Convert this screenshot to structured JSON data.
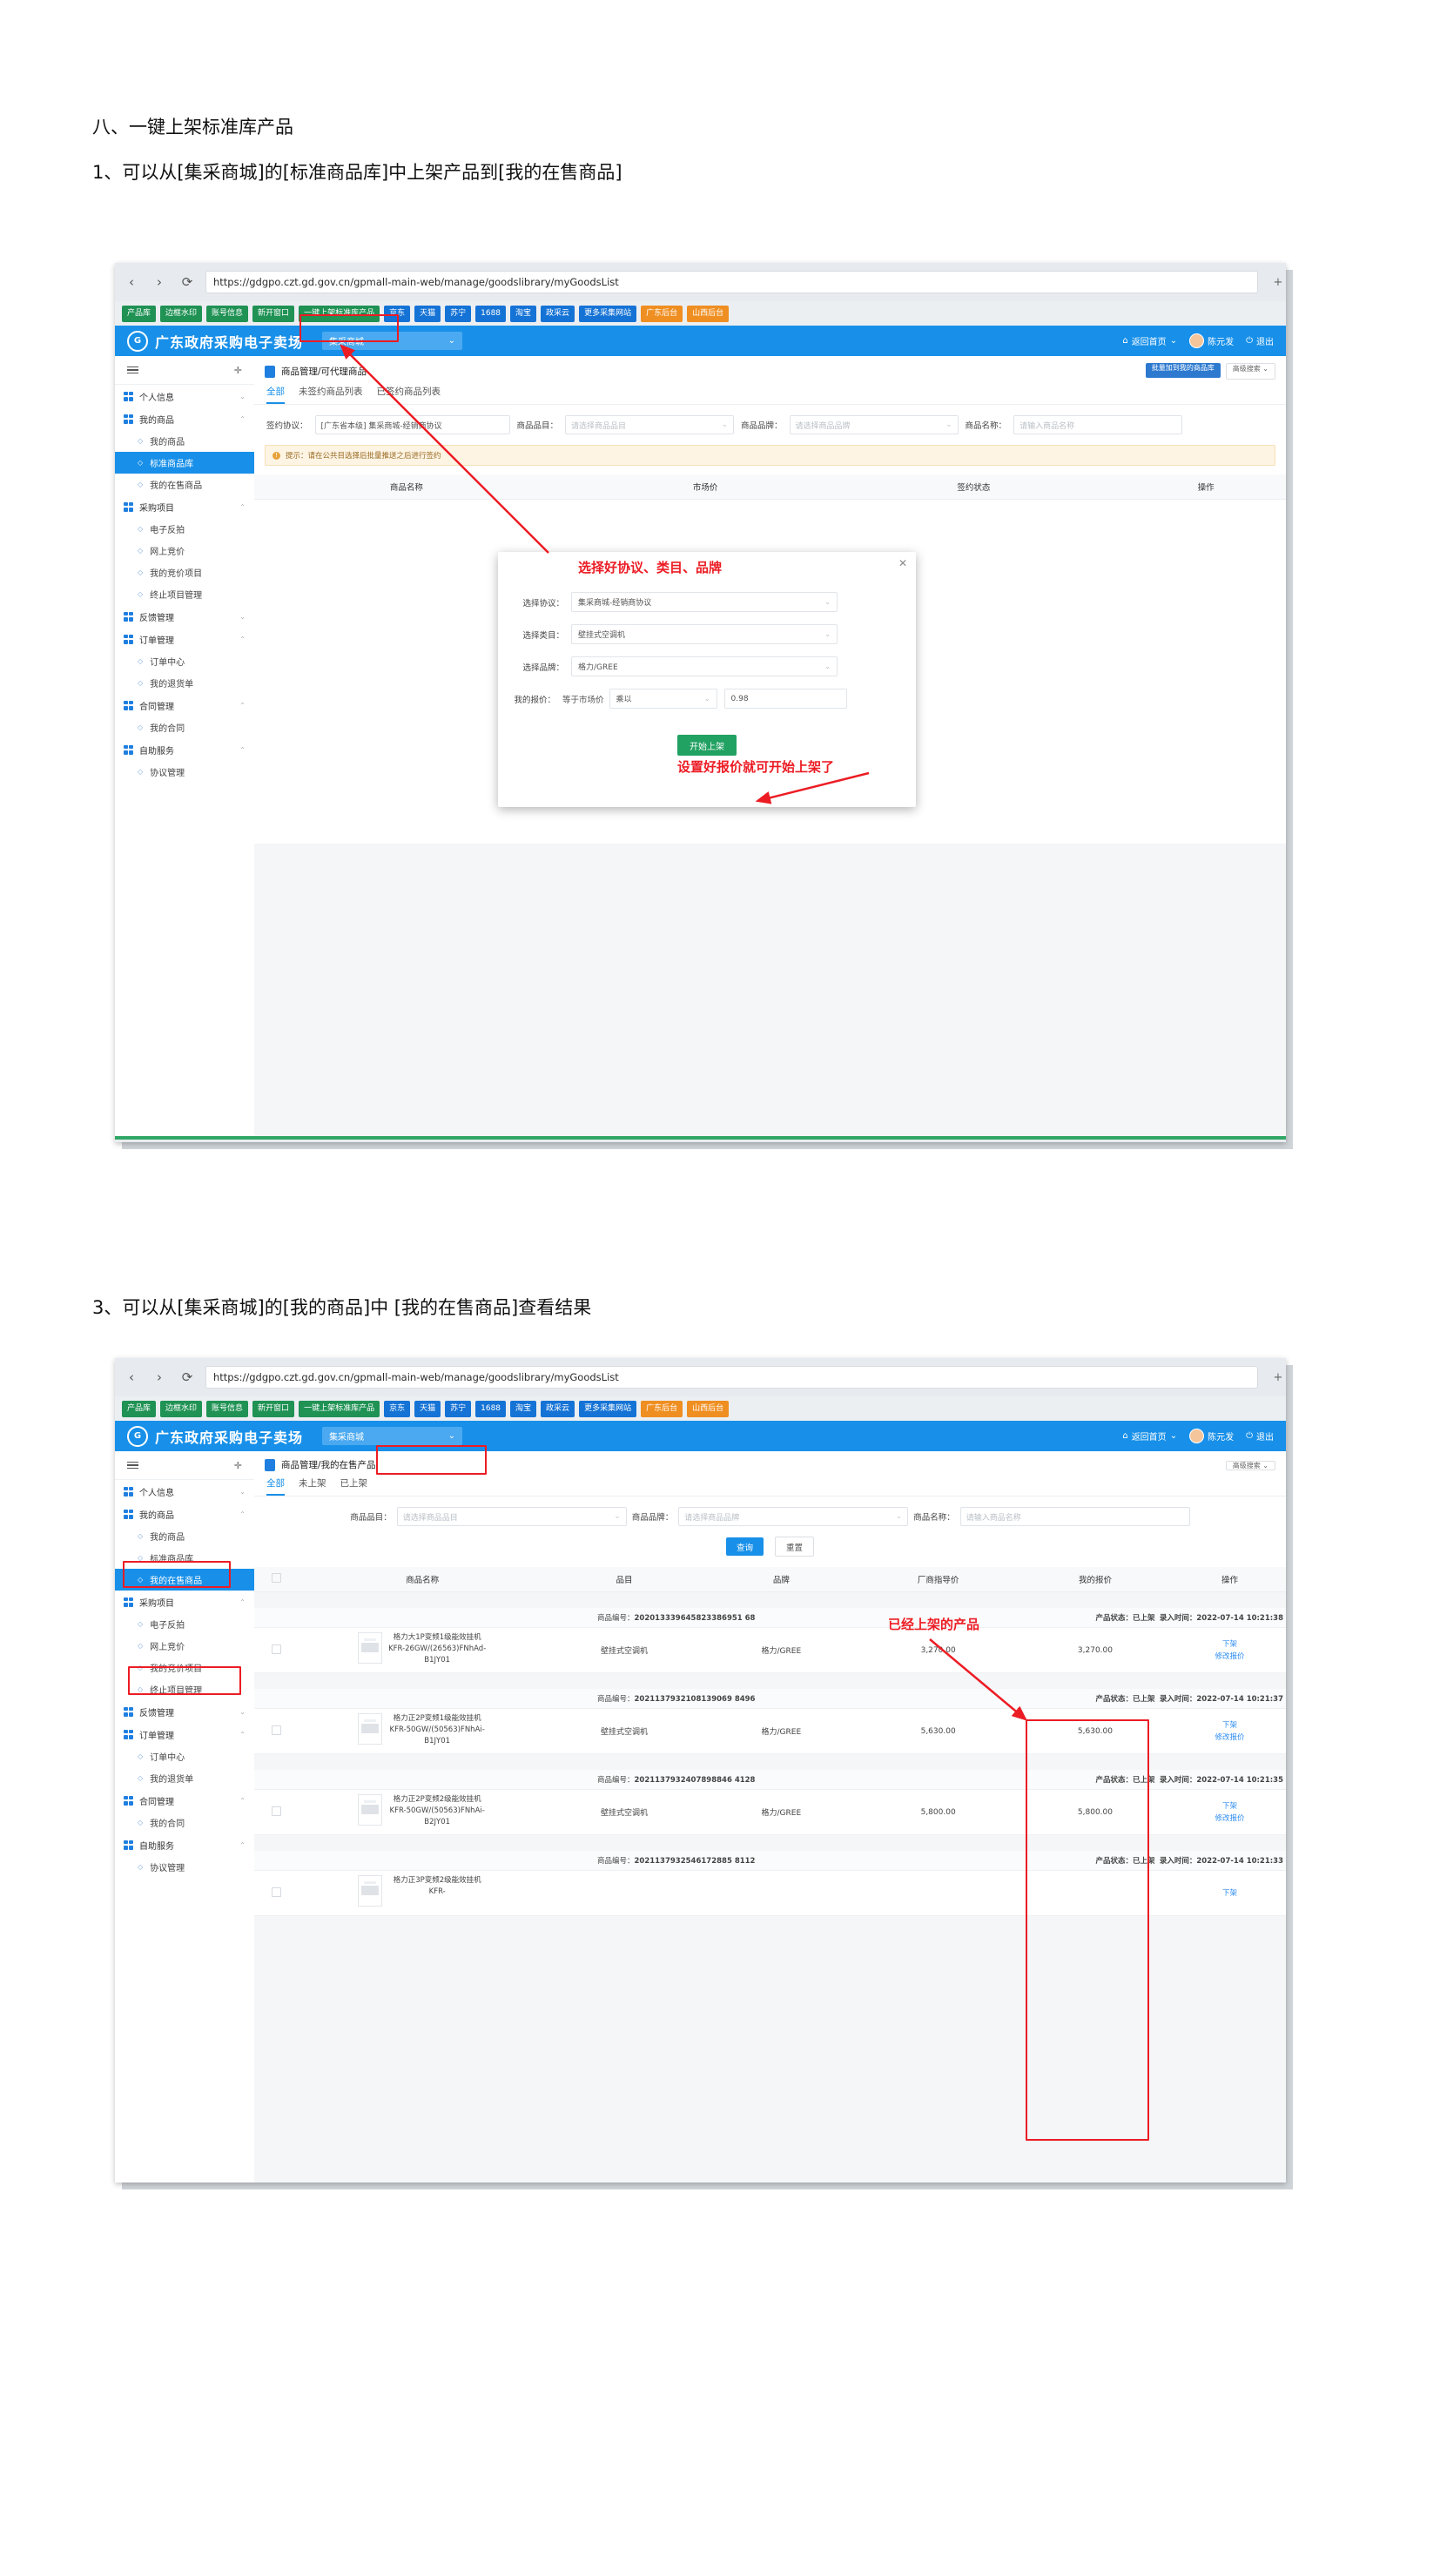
{
  "document": {
    "section_heading": "八、一键上架标准库产品",
    "line1": "1、可以从[集采商城]的[标准商品库]中上架产品到[我的在售商品]",
    "line3": "3、可以从[集采商城]的[我的商品]中 [我的在售商品]查看结果"
  },
  "browser": {
    "url": "https://gdgpo.czt.gd.gov.cn/gpmall-main-web/manage/goodslibrary/myGoodsList",
    "back_icon": "‹",
    "forward_icon": "›",
    "reload_icon": "⟳",
    "plus_icon": "+",
    "bookmarks": [
      {
        "label": "产品库",
        "color": "green"
      },
      {
        "label": "边框水印",
        "color": "green"
      },
      {
        "label": "账号信息",
        "color": "green"
      },
      {
        "label": "新开窗口",
        "color": "green"
      },
      {
        "label": "一键上架标准库产品",
        "color": "green"
      },
      {
        "label": "京东",
        "color": "blue"
      },
      {
        "label": "天猫",
        "color": "blue"
      },
      {
        "label": "苏宁",
        "color": "blue"
      },
      {
        "label": "1688",
        "color": "blue"
      },
      {
        "label": "淘宝",
        "color": "blue"
      },
      {
        "label": "政采云",
        "color": "blue"
      },
      {
        "label": "更多采集网站",
        "color": "blue"
      },
      {
        "label": "广东后台",
        "color": "orange"
      },
      {
        "label": "山西后台",
        "color": "orange"
      }
    ]
  },
  "appheader": {
    "logo_text": "G",
    "brand": "广东政府采购电子卖场",
    "mall_selector": "集采商城",
    "mall_caret": "⌄",
    "home_icon": "⌂",
    "home_label": "返回首页",
    "home_caret": "⌄",
    "user_name": "陈元发",
    "logout_icon": "⏻",
    "logout_label": "退出"
  },
  "sidebar": {
    "pin_icon": "📌",
    "groups": [
      {
        "label": "个人信息",
        "caret": "⌄",
        "children": []
      },
      {
        "label": "我的商品",
        "caret": "⌃",
        "children": [
          "我的商品",
          "标准商品库",
          "我的在售商品"
        ]
      },
      {
        "label": "采购项目",
        "caret": "⌃",
        "children": [
          "电子反拍",
          "网上竞价",
          "我的竞价项目",
          "终止项目管理"
        ]
      },
      {
        "label": "反馈管理",
        "caret": "⌄",
        "children": []
      },
      {
        "label": "订单管理",
        "caret": "⌃",
        "children": [
          "订单中心",
          "我的退货单"
        ]
      },
      {
        "label": "合同管理",
        "caret": "⌃",
        "children": [
          "我的合同"
        ]
      },
      {
        "label": "自助服务",
        "caret": "⌃",
        "children": [
          "协议管理"
        ]
      }
    ],
    "active_item_screen1": "标准商品库",
    "active_item_screen2": "我的在售商品"
  },
  "screen1": {
    "breadcrumb": "商品管理/可代理商品",
    "tabs": [
      {
        "label": "全部",
        "active": true
      },
      {
        "label": "未签约商品列表",
        "active": false
      },
      {
        "label": "已签约商品列表",
        "active": false
      }
    ],
    "top_buttons": [
      {
        "label": "批量加到我的商品库",
        "style": "primary"
      },
      {
        "label": "高级搜索 ⌄",
        "style": "default"
      }
    ],
    "filters": [
      {
        "label": "签约协议：",
        "value": "[广东省本级] 集采商城-经销商协议",
        "placeholder": "",
        "type": "text"
      },
      {
        "label": "商品品目：",
        "value": "",
        "placeholder": "请选择商品品目",
        "type": "select"
      },
      {
        "label": "商品品牌：",
        "value": "",
        "placeholder": "请选择商品品牌",
        "type": "select"
      },
      {
        "label": "商品名称：",
        "value": "",
        "placeholder": "请输入商品名称",
        "type": "text"
      }
    ],
    "notice": "提示：请在公共目选择后批量推送之后进行签约",
    "table_headers": [
      "商品名称",
      "",
      "",
      "市场价",
      "签约状态",
      "操作"
    ]
  },
  "modal": {
    "close_icon": "✕",
    "fields": [
      {
        "label": "选择协议：",
        "value": "集采商城-经销商协议"
      },
      {
        "label": "选择类目：",
        "value": "壁挂式空调机"
      },
      {
        "label": "选择品牌：",
        "value": "格力/GREE"
      }
    ],
    "price_label": "我的报价：",
    "price_prefix": "等于市场价",
    "price_op": "乘以",
    "price_factor": "0.98",
    "submit_label": "开始上架",
    "caret": "⌄"
  },
  "annotations": {
    "a1": "选择好协议、类目、品牌",
    "a2": "设置好报价就可开始上架了",
    "a3": "已经上架的产品"
  },
  "screen2": {
    "breadcrumb": "商品管理/我的在售产品",
    "advanced_search": "高级搜索 ⌄",
    "tabs": [
      {
        "label": "全部",
        "active": true
      },
      {
        "label": "未上架",
        "active": false
      },
      {
        "label": "已上架",
        "active": false
      }
    ],
    "filters": [
      {
        "label": "商品品目：",
        "placeholder": "请选择商品品目",
        "type": "select"
      },
      {
        "label": "商品品牌：",
        "placeholder": "请选择商品品牌",
        "type": "select"
      },
      {
        "label": "商品名称：",
        "placeholder": "请输入商品名称",
        "type": "text"
      }
    ],
    "search_button": "查询",
    "reset_button": "重置",
    "table_headers": [
      "商品名称",
      "品目",
      "品牌",
      "厂商指导价",
      "我的报价",
      "操作"
    ],
    "rows": [
      {
        "code_label": "商品编号：",
        "code": "202013339645823386951 68",
        "status_label": "产品状态：已上架",
        "time_label": "录入时间：2022-07-14 10:21:38",
        "name": "格力大1P变频1级能效挂机KFR-26GW/(26563)FNhAd-B1JY01",
        "category": "壁挂式空调机",
        "brand": "格力/GREE",
        "guide_price": "3,270.00",
        "my_price": "3,270.00",
        "actions": [
          "下架",
          "修改报价"
        ]
      },
      {
        "code_label": "商品编号：",
        "code": "2021137932108139069 8496",
        "status_label": "产品状态：已上架",
        "time_label": "录入时间：2022-07-14 10:21:37",
        "name": "格力正2P变频1级能效挂机KFR-50GW/(50563)FNhAi-B1JY01",
        "category": "壁挂式空调机",
        "brand": "格力/GREE",
        "guide_price": "5,630.00",
        "my_price": "5,630.00",
        "actions": [
          "下架",
          "修改报价"
        ]
      },
      {
        "code_label": "商品编号：",
        "code": "2021137932407898846 4128",
        "status_label": "产品状态：已上架",
        "time_label": "录入时间：2022-07-14 10:21:35",
        "name": "格力正2P变频2级能效挂机KFR-50GW/(50563)FNhAi-B2JY01",
        "category": "壁挂式空调机",
        "brand": "格力/GREE",
        "guide_price": "5,800.00",
        "my_price": "5,800.00",
        "actions": [
          "下架",
          "修改报价"
        ]
      },
      {
        "code_label": "商品编号：",
        "code": "2021137932546172885 8112",
        "status_label": "产品状态：已上架",
        "time_label": "录入时间：2022-07-14 10:21:33",
        "name": "格力正3P变频2级能效挂机KFR-",
        "category": "",
        "brand": "",
        "guide_price": "",
        "my_price": "",
        "actions": [
          "下架"
        ]
      }
    ]
  }
}
